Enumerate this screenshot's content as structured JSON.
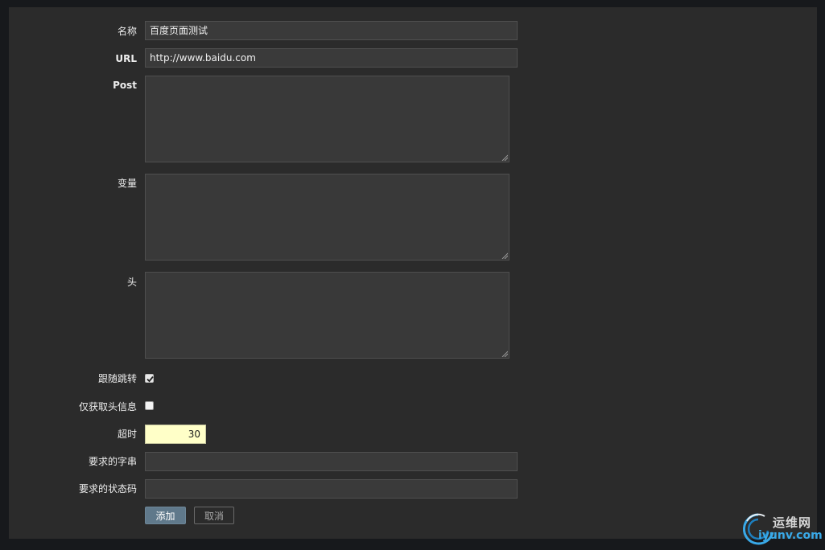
{
  "form": {
    "name": {
      "label": "名称",
      "value": "百度页面测试"
    },
    "url": {
      "label": "URL",
      "value": "http://www.baidu.com"
    },
    "post": {
      "label": "Post",
      "value": ""
    },
    "variables": {
      "label": "变量",
      "value": ""
    },
    "headers": {
      "label": "头",
      "value": ""
    },
    "follow_redirects": {
      "label": "跟随跳转",
      "checked": true
    },
    "headers_only": {
      "label": "仅获取头信息",
      "checked": false
    },
    "timeout": {
      "label": "超时",
      "value": "30"
    },
    "required_string": {
      "label": "要求的字串",
      "value": ""
    },
    "required_status": {
      "label": "要求的状态码",
      "value": ""
    }
  },
  "buttons": {
    "add": "添加",
    "cancel": "取消"
  },
  "watermark": {
    "cn": "运维网",
    "en": "iyunv.com"
  },
  "colors": {
    "page_bg": "#17191c",
    "panel_bg": "#2b2b2b",
    "input_bg": "#3a3a3a",
    "primary_button": "#60798b",
    "timeout_bg": "#ffffc8",
    "watermark_blue": "#39a9e8"
  }
}
